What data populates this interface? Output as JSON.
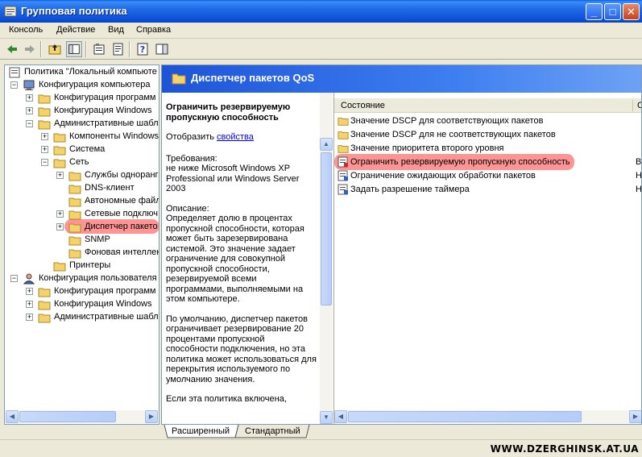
{
  "window": {
    "title": "Групповая политика",
    "buttons": {
      "minimize": "_",
      "maximize": "□",
      "close": "✕"
    }
  },
  "menu": {
    "items": [
      "Консоль",
      "Действие",
      "Вид",
      "Справка"
    ]
  },
  "tree": {
    "root": "Политика \"Локальный компьюте",
    "items": [
      "Конфигурация компьютера",
      "Конфигурация программ",
      "Конфигурация Windows",
      "Административные шабл",
      "Компоненты Windows",
      "Система",
      "Сеть",
      "Службы одноранг",
      "DNS-клиент",
      "Автономные файл",
      "Сетевые подключ",
      "Диспетчер пакето",
      "SNMP",
      "Фоновая интеллек",
      "Принтеры",
      "Конфигурация пользователя",
      "Конфигурация программ",
      "Конфигурация Windows",
      "Административные шабл"
    ]
  },
  "header": {
    "title": "Диспетчер пакетов QoS"
  },
  "description": {
    "title": "Ограничить резервируемую пропускную способность",
    "show_prefix": "Отобразить ",
    "show_link": "свойства",
    "requirements": "Требования:\nне ниже Microsoft Windows XP Professional или Windows Server 2003",
    "description": "Описание:\nОпределяет долю в процентах пропускной способности, которая может быть зарезервирована системой. Это значение задает ограничение для совокупной пропускной способности, резервируемой всеми программами, выполняемыми на этом компьютере.",
    "default": "По умолчанию, диспетчер пакетов ограничивает резервирование 20 процентами пропускной способности подключения, но эта политика может использоваться для перекрытия используемого по умолчанию значения.",
    "enabled": "Если эта политика включена,"
  },
  "list": {
    "columns": {
      "name": "Состояние",
      "state": "С"
    },
    "rows": [
      {
        "label": "Значение DSCP для соответствующих пакетов",
        "state": ""
      },
      {
        "label": "Значение DSCP для не соответствующих пакетов",
        "state": ""
      },
      {
        "label": "Значение приоритета второго уровня",
        "state": ""
      },
      {
        "label": "Ограничить резервируемую пропускную способность",
        "state": "В"
      },
      {
        "label": "Ограничение ожидающих обработки пакетов",
        "state": "Н"
      },
      {
        "label": "Задать разрешение таймера",
        "state": "Н"
      }
    ]
  },
  "tabs": [
    "Расширенный",
    "Стандартный"
  ],
  "watermark": "WWW.DZERGHINSK.AT.UA",
  "colors": {
    "title_bar": "#0b4fd6",
    "header_bar": "#1d54d8",
    "highlight": "#ff3c3c",
    "folder": "#f5d36b",
    "link": "#0000ff"
  }
}
